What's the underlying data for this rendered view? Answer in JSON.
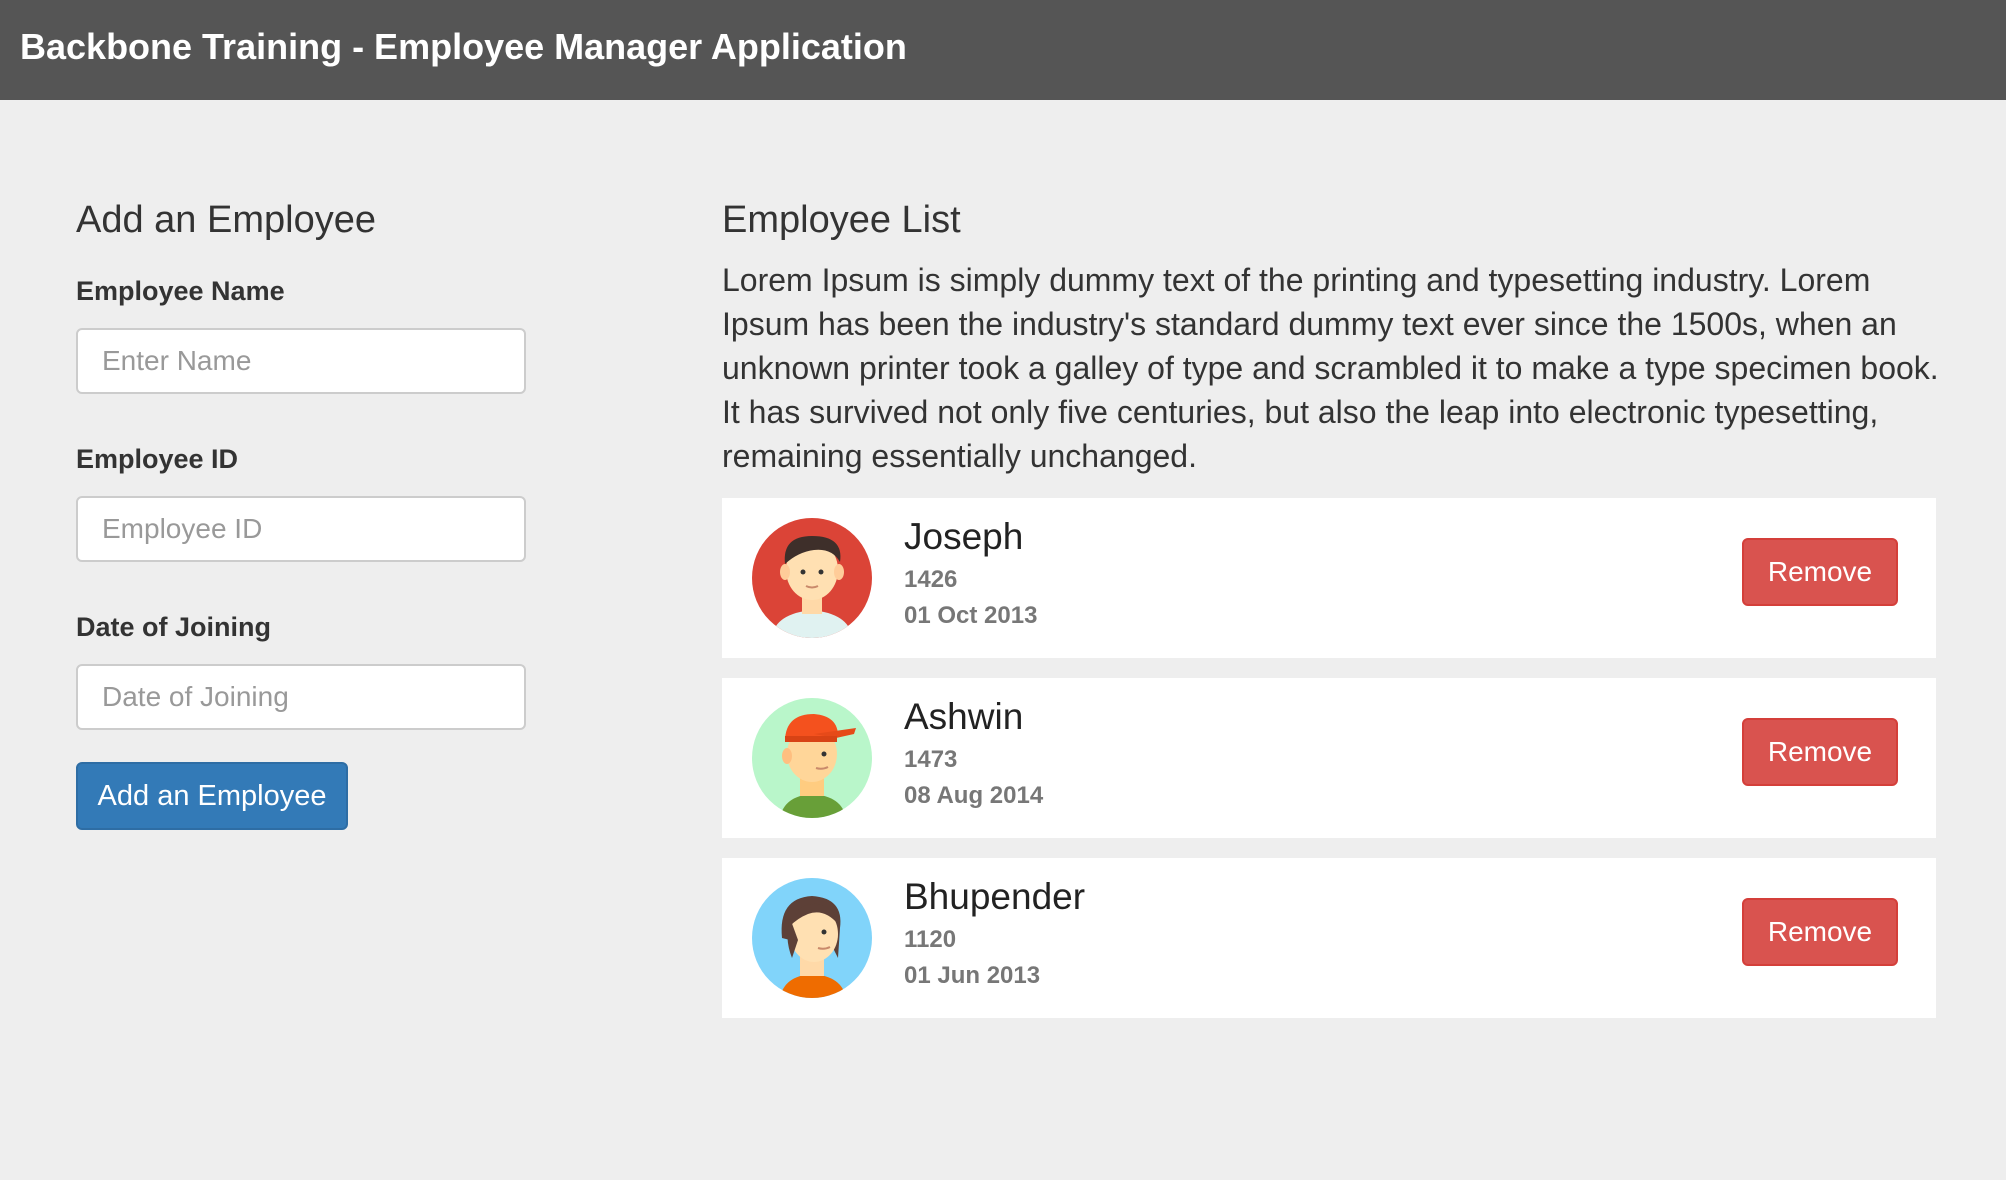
{
  "app": {
    "title": "Backbone Training - Employee Manager Application"
  },
  "form": {
    "heading": "Add an Employee",
    "name_label": "Employee Name",
    "name_placeholder": "Enter Name",
    "name_value": "",
    "id_label": "Employee ID",
    "id_placeholder": "Employee ID",
    "id_value": "",
    "date_label": "Date of Joining",
    "date_placeholder": "Date of Joining",
    "date_value": "",
    "submit_label": "Add an Employee"
  },
  "list": {
    "heading": "Employee List",
    "description": "Lorem Ipsum is simply dummy text of the printing and typesetting industry. Lorem Ipsum has been the industry's standard dummy text ever since the 1500s, when an unknown printer took a galley of type and scrambled it to make a type specimen book. It has survived not only five centuries, but also the leap into electronic typesetting, remaining essentially unchanged.",
    "employees": [
      {
        "name": "Joseph",
        "id": "1426",
        "date": "01 Oct 2013",
        "avatar": "man-avatar-icon",
        "remove_label": "Remove"
      },
      {
        "name": "Ashwin",
        "id": "1473",
        "date": "08 Aug 2014",
        "avatar": "man-with-cap-avatar-icon",
        "remove_label": "Remove"
      },
      {
        "name": "Bhupender",
        "id": "1120",
        "date": "01 Jun 2013",
        "avatar": "woman-avatar-icon",
        "remove_label": "Remove"
      }
    ]
  },
  "colors": {
    "topbar": "#555555",
    "page_background": "#eeeeee",
    "primary_button": "#337ab7",
    "danger_button": "#d9534f",
    "avatar_joseph_bg": "#db4437",
    "avatar_ashwin_bg": "#b9f6ca",
    "avatar_bhupender_bg": "#81d4fa"
  }
}
